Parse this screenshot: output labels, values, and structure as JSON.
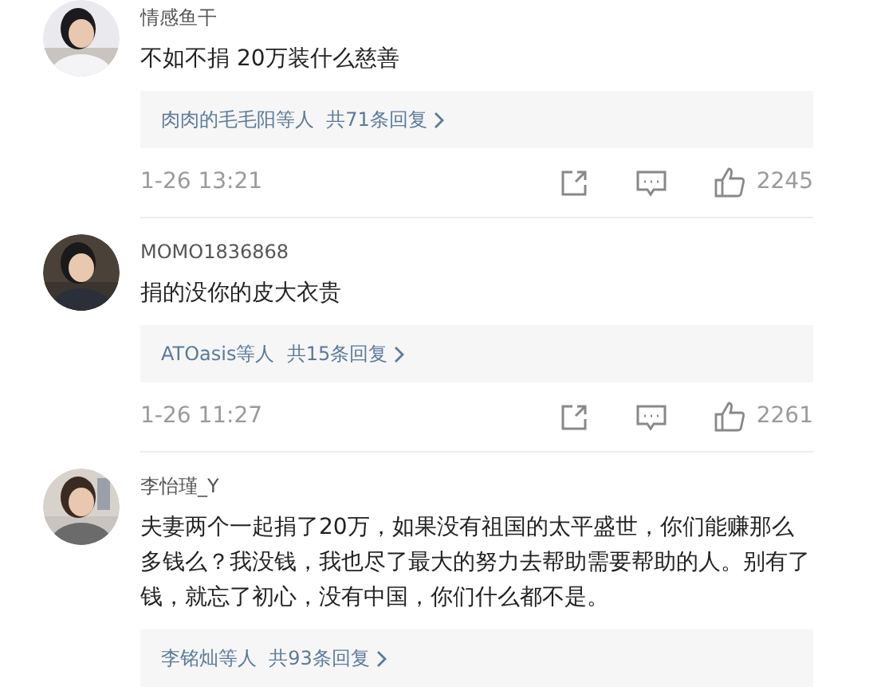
{
  "comments": [
    {
      "user": "情感鱼干",
      "text": "不如不捐 20万装什么慈善",
      "replies": "肉肉的毛毛阳等人  共71条回复",
      "time": "1-26 13:21",
      "likes": "2245"
    },
    {
      "user": "MOMO1836868",
      "text": "捐的没你的皮大衣贵",
      "replies": "ATOasis等人  共15条回复",
      "time": "1-26 11:27",
      "likes": "2261"
    },
    {
      "user": "李怡瑾_Y",
      "text": "夫妻两个一起捐了20万，如果没有祖国的太平盛世，你们能赚那么多钱么？我没钱，我也尽了最大的努力去帮助需要帮助的人。别有了钱，就忘了初心，没有中国，你们什么都不是。",
      "replies": "李铭灿等人  共93条回复"
    }
  ]
}
